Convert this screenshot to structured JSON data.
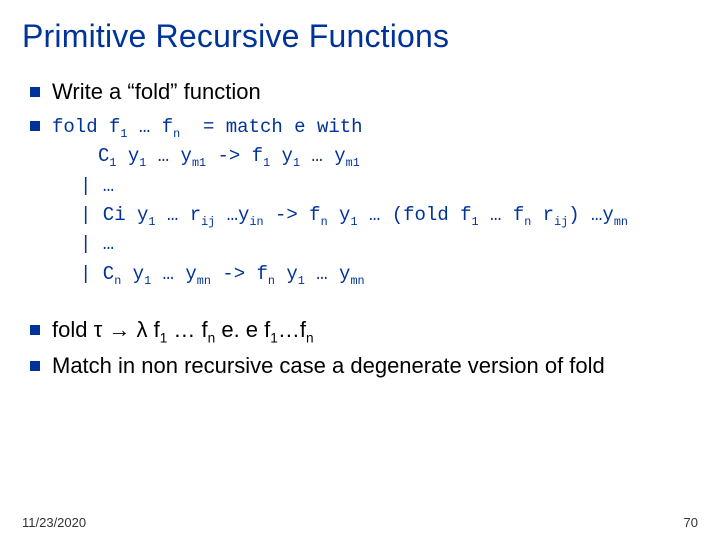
{
  "title": "Primitive Recursive Functions",
  "bullets": {
    "b1": "Write a “fold” function",
    "code": {
      "l1": "fold f₁ … fₙ  = match e with",
      "l2": "C₁ y₁ … yₘ₁ -> f₁ y₁ … yₘ₁",
      "l3": "| …",
      "l4": "| Ci y₁ … rᵢⱼ …yᵢₙ -> fₙ y₁ … (fold f₁ … fₙ rᵢⱼ) …yₘₙ",
      "l5": "| …",
      "l6": "| Cₙ y₁ … yₘₙ -> fₙ y₁ … yₘₙ"
    },
    "b3": "fold τ → λ f₁ … fₙ e. e f₁…fₙ",
    "b4": "Match in non recursive case a degenerate version of fold"
  },
  "footer": {
    "date": "11/23/2020",
    "page": "70"
  }
}
